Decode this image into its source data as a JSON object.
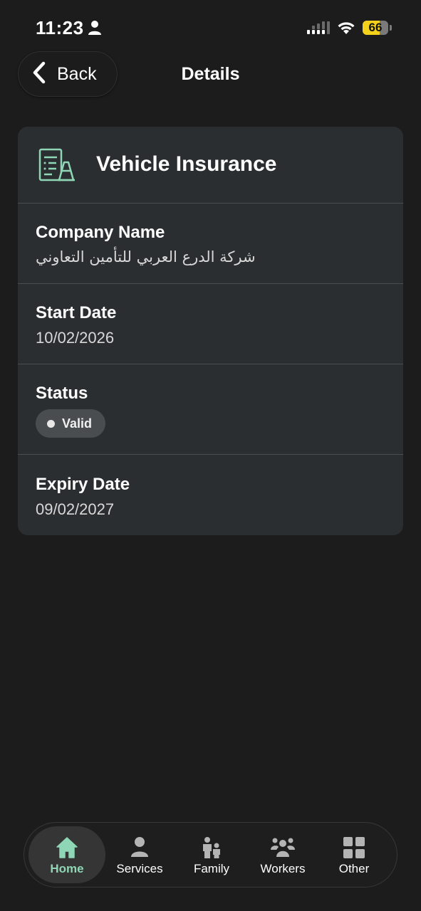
{
  "status_bar": {
    "time": "11:23",
    "battery": "66",
    "battery_level": 0.66,
    "colors": {
      "battery": "#f4d21c"
    }
  },
  "header": {
    "back_label": "Back",
    "title": "Details"
  },
  "card": {
    "title": "Vehicle Insurance",
    "icon": "document-cone-icon",
    "fields": [
      {
        "label": "Company Name",
        "value": "شركة الدرع العربي للتأمين التعاوني"
      },
      {
        "label": "Start Date",
        "value": "10/02/2026"
      },
      {
        "label": "Status",
        "badge": "Valid"
      },
      {
        "label": "Expiry Date",
        "value": "09/02/2027"
      }
    ]
  },
  "bottom_nav": {
    "active": "Home",
    "accent_color": "#8fd6b6",
    "items": [
      {
        "label": "Home",
        "icon": "home-icon"
      },
      {
        "label": "Services",
        "icon": "person-icon"
      },
      {
        "label": "Family",
        "icon": "family-icon"
      },
      {
        "label": "Workers",
        "icon": "workers-icon"
      },
      {
        "label": "Other",
        "icon": "grid-icon"
      }
    ]
  }
}
